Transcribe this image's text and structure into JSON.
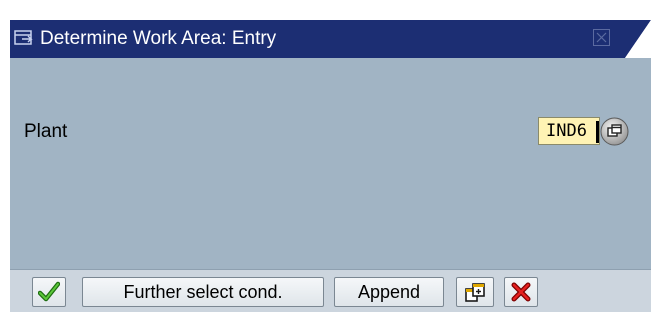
{
  "dialog": {
    "title": "Determine Work Area: Entry",
    "title_icon": "window-icon",
    "close_icon": "close-icon"
  },
  "form": {
    "plant_label": "Plant",
    "plant_value": "IND6",
    "search_help_icon": "f4-search-help-icon"
  },
  "toolbar": {
    "confirm_icon": "checkmark-icon",
    "further_select_label": "Further select cond.",
    "append_label": "Append",
    "multiple_selection_icon": "multiple-selection-icon",
    "cancel_icon": "cancel-x-icon"
  },
  "colors": {
    "title_bar": "#1c2e73",
    "body": "#a1b4c4",
    "input_bg": "#fff3b4",
    "toolbar_bg": "#ccd5de"
  }
}
